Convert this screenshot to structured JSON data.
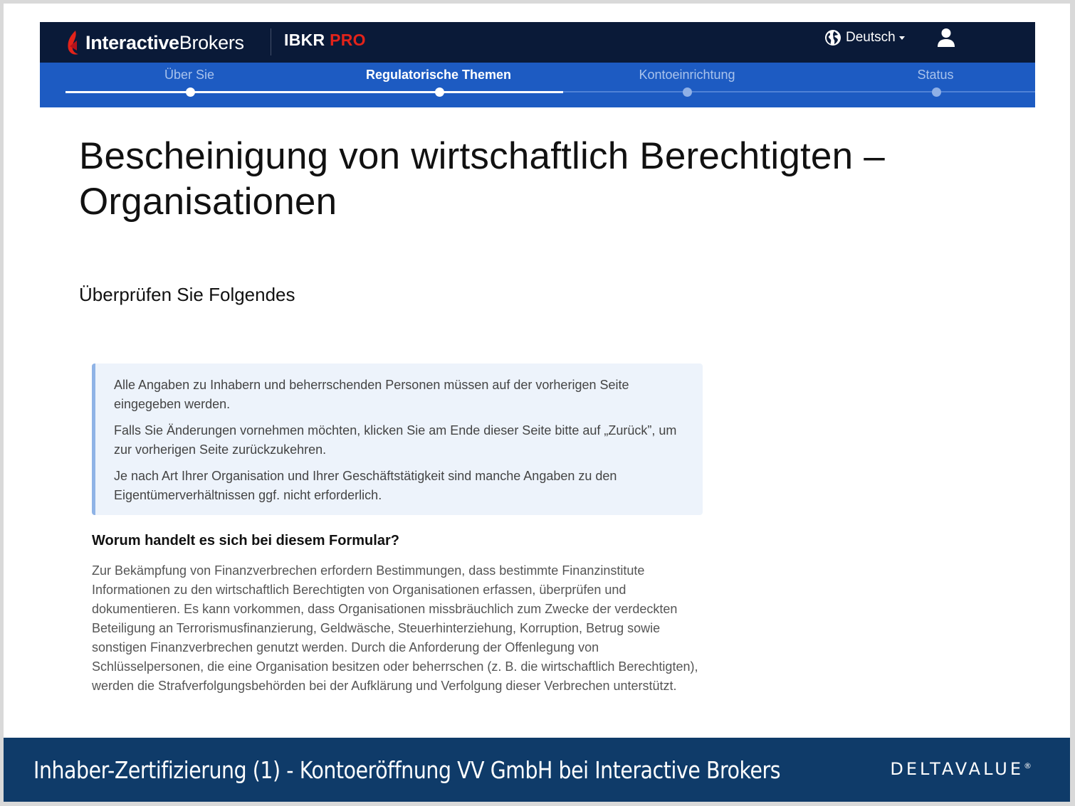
{
  "header": {
    "logo_bold": "Interactive",
    "logo_light": "Brokers",
    "product_main": "IBKR",
    "product_accent": "PRO",
    "language": "Deutsch"
  },
  "steps": [
    {
      "label": "Über Sie",
      "state": "done"
    },
    {
      "label": "Regulatorische Themen",
      "state": "active"
    },
    {
      "label": "Kontoeinrichtung",
      "state": "todo"
    },
    {
      "label": "Status",
      "state": "todo"
    }
  ],
  "main": {
    "title": "Bescheinigung von wirtschaftlich Berechtigten – Organisationen",
    "subtitle": "Überprüfen Sie Folgendes",
    "info": [
      "Alle Angaben zu Inhabern und beherrschenden Personen müssen auf der vorherigen Seite eingegeben werden.",
      "Falls Sie Änderungen vornehmen möchten, klicken Sie am Ende dieser Seite bitte auf „Zurück”, um zur vorherigen Seite zurückzukehren.",
      "Je nach Art Ihrer Organisation und Ihrer Geschäftstätigkeit sind manche Angaben zu den Eigentümerverhältnissen ggf. nicht erforderlich."
    ],
    "question": "Worum handelt es sich bei diesem Formular?",
    "body": "Zur Bekämpfung von Finanzverbrechen erfordern Bestimmungen, dass bestimmte Finanzinstitute Informationen zu den wirtschaftlich Berechtigten von Organisationen erfassen, überprüfen und dokumentieren. Es kann vorkommen, dass Organisationen missbräuchlich zum Zwecke der verdeckten Beteiligung an Terrorismusfinanzierung, Geldwäsche, Steuerhinterziehung, Korruption, Betrug sowie sonstigen Finanzverbrechen genutzt werden. Durch die Anforderung der Offenlegung von Schlüsselpersonen, die eine Organisation besitzen oder beherrschen (z. B. die wirtschaftlich Berechtigten), werden die Strafverfolgungsbehörden bei der Aufklärung und Verfolgung dieser Verbrechen unterstützt."
  },
  "caption": {
    "text": "Inhaber-Zertifizierung (1) - Kontoeröffnung VV GmbH bei Interactive Brokers",
    "brand": "DELTAVALUE",
    "brand_mark": "®"
  },
  "colors": {
    "header_bg": "#0a1a38",
    "steps_bg": "#1d5bc2",
    "accent_red": "#e2231a",
    "caption_bg": "#0f3b69",
    "info_bg": "#edf3fb"
  },
  "icons": [
    "logo-flame-icon",
    "globe-icon",
    "caret-down-icon",
    "user-icon"
  ]
}
